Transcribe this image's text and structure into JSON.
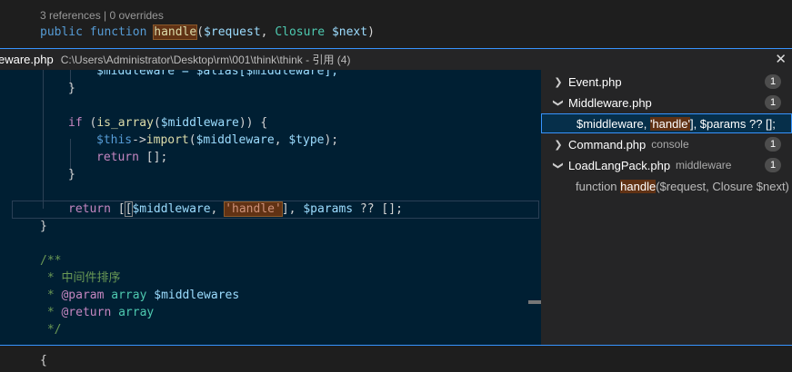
{
  "top": {
    "codelens": "3 references | 0 overrides",
    "sig_public": "public",
    "sig_function": "function",
    "sig_name": "handle",
    "sig_rest_open": "(",
    "sig_param1": "$request",
    "sig_comma": ", ",
    "sig_type": "Closure",
    "sig_space": " ",
    "sig_param2": "$next",
    "sig_close": ")"
  },
  "peek": {
    "file": "eware.php",
    "path": "C:\\Users\\Administrator\\Desktop\\rm\\001\\think\\think - 引用 (4)",
    "close": "✕"
  },
  "code": {
    "l0": "$middleware = $alias[$middleware];",
    "l1": "}",
    "l3a": "if",
    "l3b": " (",
    "l3c": "is_array",
    "l3d": "(",
    "l3e": "$middleware",
    "l3f": ")) {",
    "l4a": "$this",
    "l4b": "->",
    "l4c": "import",
    "l4d": "(",
    "l4e": "$middleware",
    "l4f": ", ",
    "l4g": "$type",
    "l4h": ");",
    "l5a": "return",
    "l5b": " [];",
    "l6": "}",
    "l8a": "return",
    "l8b": " [",
    "l8c": "[",
    "l8d": "$middleware",
    "l8e": ", ",
    "l8f": "'handle'",
    "l8g": "], ",
    "l8h": "$params",
    "l8i": " ?? [];",
    "l9": "}",
    "l11": "/**",
    "l12": " * 中间件排序",
    "l13a": " * ",
    "l13b": "@param",
    "l13c": " array ",
    "l13d": "$middlewares",
    "l14a": " * ",
    "l14b": "@return",
    "l14c": " array",
    "l15": " */"
  },
  "tree": {
    "r1_file": "Event.php",
    "r1_count": "1",
    "r2_file": "Middleware.php",
    "r2_count": "1",
    "r3_pre": "$middleware, ",
    "r3_hl": "'handle'",
    "r3_post": "], $params ?? [];",
    "r4_file": "Command.php",
    "r4_desc": "console",
    "r4_count": "1",
    "r5_file": "LoadLangPack.php",
    "r5_desc": "middleware",
    "r5_count": "1",
    "r6_pre": "function ",
    "r6_hl": "handle",
    "r6_post": "($request, Closure $next)"
  },
  "bottom": {
    "brace": "{"
  }
}
